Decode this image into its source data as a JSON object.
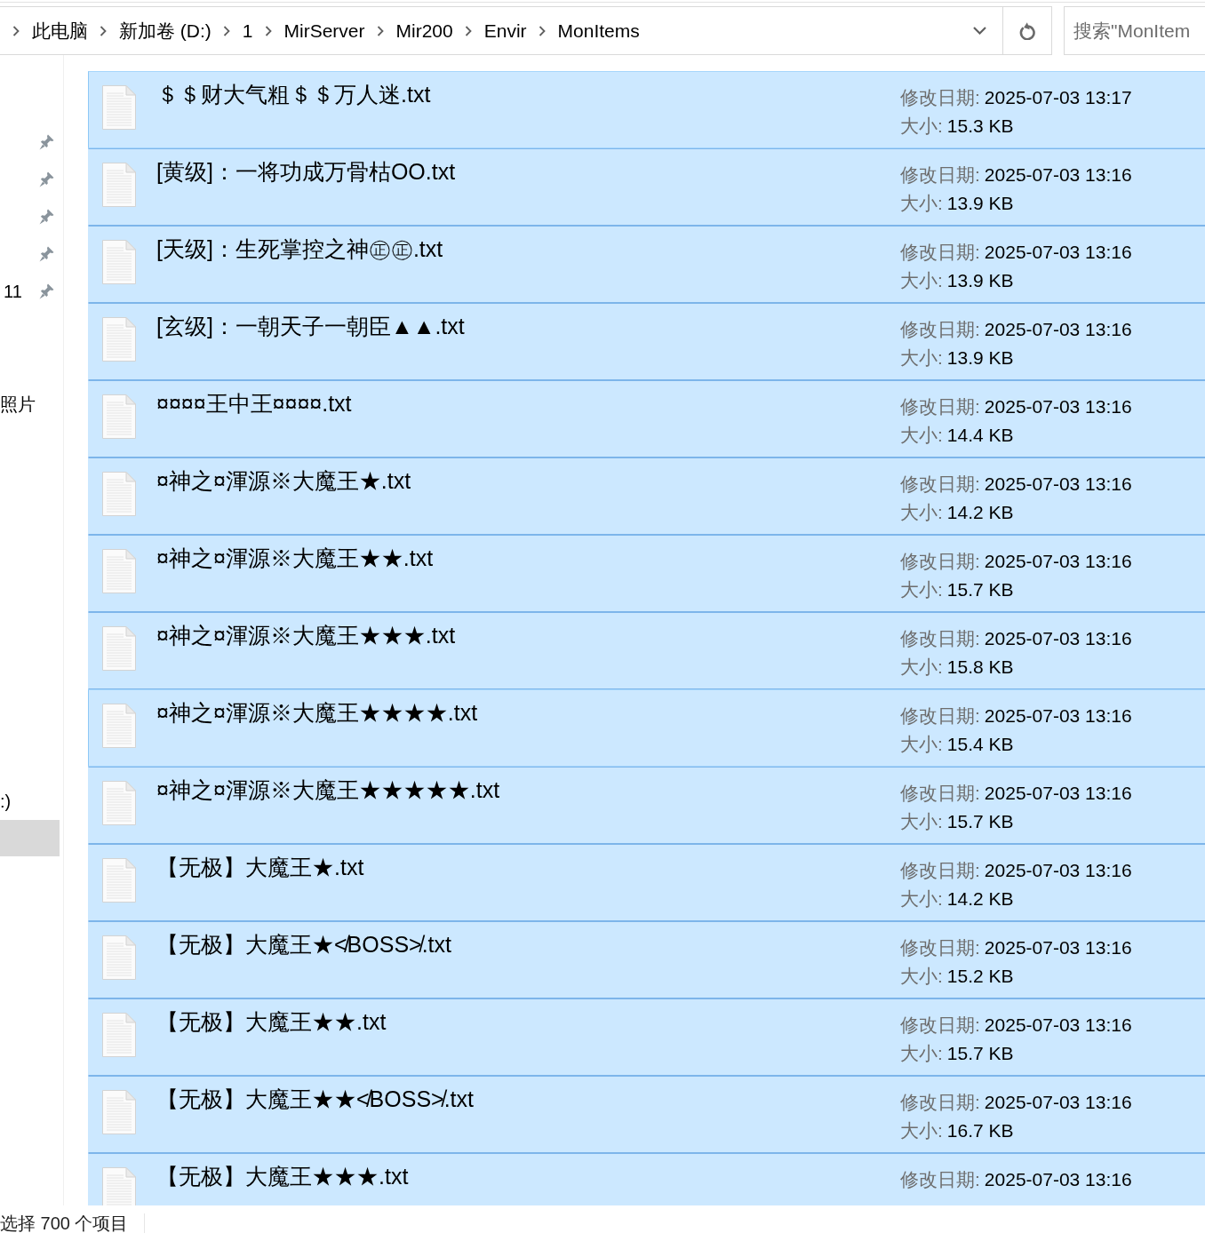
{
  "address_bar": {
    "breadcrumbs": [
      "此电脑",
      "新加卷 (D:)",
      "1",
      "MirServer",
      "Mir200",
      "Envir",
      "MonItems"
    ],
    "search": {
      "placeholder": "搜索\"MonItem"
    }
  },
  "sidebar": {
    "groups": [
      {
        "items": [
          {
            "pinned": true,
            "selected": false
          },
          {
            "pinned": true,
            "selected": false
          },
          {
            "pinned": true,
            "selected": false
          },
          {
            "pinned": true,
            "selected": false
          },
          {
            "label": "11",
            "pinned": true,
            "selected": false
          }
        ]
      },
      {
        "items": [
          {
            "label": "照片",
            "pinned": false,
            "selected": false
          }
        ]
      },
      {
        "items": [
          {
            "label": ":)",
            "pinned": false,
            "selected": false
          },
          {
            "pinned": false,
            "selected": true
          }
        ]
      }
    ]
  },
  "file_list": {
    "items": [
      {
        "name": "＄＄财大气粗＄＄万人迷.txt",
        "modified_label": "修改日期:",
        "modified": "2025-07-03 13:17",
        "size_label": "大小:",
        "size": "15.3 KB",
        "selected": true,
        "focused": true,
        "hovered": false
      },
      {
        "name": "[黄级]：一将功成万骨枯OO.txt",
        "modified_label": "修改日期:",
        "modified": "2025-07-03 13:16",
        "size_label": "大小:",
        "size": "13.9 KB",
        "selected": true,
        "focused": false,
        "hovered": false
      },
      {
        "name": "[天级]：生死掌控之神㊣㊣.txt",
        "modified_label": "修改日期:",
        "modified": "2025-07-03 13:16",
        "size_label": "大小:",
        "size": "13.9 KB",
        "selected": true,
        "focused": false,
        "hovered": false
      },
      {
        "name": "[玄级]：一朝天子一朝臣▲▲.txt",
        "modified_label": "修改日期:",
        "modified": "2025-07-03 13:16",
        "size_label": "大小:",
        "size": "13.9 KB",
        "selected": true,
        "focused": false,
        "hovered": false
      },
      {
        "name": "¤¤¤¤王中王¤¤¤¤.txt",
        "modified_label": "修改日期:",
        "modified": "2025-07-03 13:16",
        "size_label": "大小:",
        "size": "14.4 KB",
        "selected": true,
        "focused": false,
        "hovered": false
      },
      {
        "name": "¤神之¤渾源※大魔王★.txt",
        "modified_label": "修改日期:",
        "modified": "2025-07-03 13:16",
        "size_label": "大小:",
        "size": "14.2 KB",
        "selected": true,
        "focused": false,
        "hovered": false
      },
      {
        "name": "¤神之¤渾源※大魔王★★.txt",
        "modified_label": "修改日期:",
        "modified": "2025-07-03 13:16",
        "size_label": "大小:",
        "size": "15.7 KB",
        "selected": true,
        "focused": false,
        "hovered": false
      },
      {
        "name": "¤神之¤渾源※大魔王★★★.txt",
        "modified_label": "修改日期:",
        "modified": "2025-07-03 13:16",
        "size_label": "大小:",
        "size": "15.8 KB",
        "selected": true,
        "focused": false,
        "hovered": false
      },
      {
        "name": "¤神之¤渾源※大魔王★★★★.txt",
        "modified_label": "修改日期:",
        "modified": "2025-07-03 13:16",
        "size_label": "大小:",
        "size": "15.4 KB",
        "selected": true,
        "focused": false,
        "hovered": true
      },
      {
        "name": "¤神之¤渾源※大魔王★★★★★.txt",
        "modified_label": "修改日期:",
        "modified": "2025-07-03 13:16",
        "size_label": "大小:",
        "size": "15.7 KB",
        "selected": true,
        "focused": false,
        "hovered": false
      },
      {
        "name": "【无极】大魔王★.txt",
        "modified_label": "修改日期:",
        "modified": "2025-07-03 13:16",
        "size_label": "大小:",
        "size": "14.2 KB",
        "selected": true,
        "focused": false,
        "hovered": false
      },
      {
        "name": "【无极】大魔王★≮BOSS≯.txt",
        "modified_label": "修改日期:",
        "modified": "2025-07-03 13:16",
        "size_label": "大小:",
        "size": "15.2 KB",
        "selected": true,
        "focused": false,
        "hovered": false
      },
      {
        "name": "【无极】大魔王★★.txt",
        "modified_label": "修改日期:",
        "modified": "2025-07-03 13:16",
        "size_label": "大小:",
        "size": "15.7 KB",
        "selected": true,
        "focused": false,
        "hovered": false
      },
      {
        "name": "【无极】大魔王★★≮BOSS≯.txt",
        "modified_label": "修改日期:",
        "modified": "2025-07-03 13:16",
        "size_label": "大小:",
        "size": "16.7 KB",
        "selected": true,
        "focused": false,
        "hovered": false
      },
      {
        "name": "【无极】大魔王★★★.txt",
        "modified_label": "修改日期:",
        "modified": "2025-07-03 13:16",
        "selected": true,
        "focused": false,
        "hovered": false
      }
    ]
  },
  "status_bar": {
    "text": "选择 700 个项目"
  }
}
